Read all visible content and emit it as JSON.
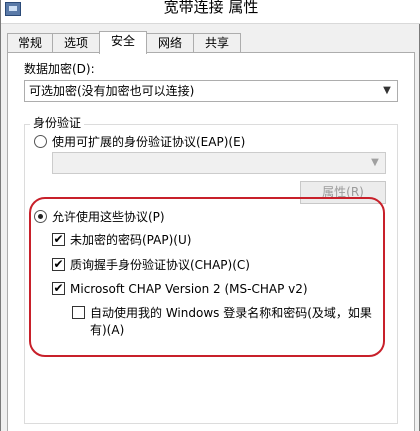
{
  "window": {
    "title": "宽带连接 属性"
  },
  "tabs": [
    {
      "label": "常规",
      "active": false
    },
    {
      "label": "选项",
      "active": false
    },
    {
      "label": "安全",
      "active": true
    },
    {
      "label": "网络",
      "active": false
    },
    {
      "label": "共享",
      "active": false
    }
  ],
  "security": {
    "data_encryption_label": "数据加密(D):",
    "data_encryption_value": "可选加密(没有加密也可以连接)",
    "auth_group_title": "身份验证",
    "eap_radio_label": "使用可扩展的身份验证协议(EAP)(E)",
    "eap_radio_checked": false,
    "eap_combo_value": "",
    "properties_button": "属性(R)",
    "allow_protocols_label": "允许使用这些协议(P)",
    "allow_protocols_checked": true,
    "protocols": [
      {
        "label": "未加密的密码(PAP)(U)",
        "checked": true
      },
      {
        "label": "质询握手身份验证协议(CHAP)(C)",
        "checked": true
      },
      {
        "label": "Microsoft CHAP Version 2 (MS-CHAP v2)",
        "checked": true
      }
    ],
    "auto_logon": {
      "line1": "自动使用我的 Windows 登录名称和密码(及域，如果",
      "line2": "有)(A)",
      "checked": false
    }
  },
  "icons": {
    "window_icon": "network-connection-icon",
    "dropdown_arrow": "chevron-down-icon",
    "checkmark": "✔"
  },
  "colors": {
    "highlight_annotation": "#c8202a",
    "selected_tab_bg": "#ffffff",
    "window_bg": "#f0f0f0"
  }
}
